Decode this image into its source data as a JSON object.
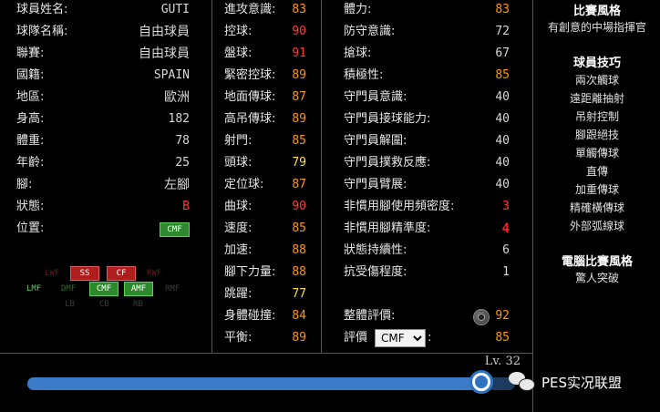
{
  "profile": {
    "rows": [
      {
        "label": "球員姓名:",
        "value": "GUTI"
      },
      {
        "label": "球隊名稱:",
        "value": "自由球員"
      },
      {
        "label": "聯賽:",
        "value": "自由球員"
      },
      {
        "label": "國籍:",
        "value": "SPAIN"
      },
      {
        "label": "地區:",
        "value": "歐洲"
      },
      {
        "label": "身高:",
        "value": "182"
      },
      {
        "label": "體重:",
        "value": "78"
      },
      {
        "label": "年齡:",
        "value": "25"
      },
      {
        "label": "腳:",
        "value": "左腳"
      },
      {
        "label": "狀態:",
        "value": "B"
      }
    ],
    "position_label": "位置:",
    "position_value": "CMF",
    "position_map": {
      "row1": [
        "LWF",
        "SS",
        "CF",
        "RWF"
      ],
      "row2": [
        "LMF",
        "DMF",
        "CMF",
        "AMF",
        "RMF"
      ],
      "row3": [
        "LB",
        "CB",
        "RB"
      ]
    }
  },
  "attributes_col1": [
    {
      "label": "進攻意識:",
      "value": "83"
    },
    {
      "label": "控球:",
      "value": "90"
    },
    {
      "label": "盤球:",
      "value": "91"
    },
    {
      "label": "緊密控球:",
      "value": "89"
    },
    {
      "label": "地面傳球:",
      "value": "87"
    },
    {
      "label": "高吊傳球:",
      "value": "89"
    },
    {
      "label": "射門:",
      "value": "85"
    },
    {
      "label": "頭球:",
      "value": "79"
    },
    {
      "label": "定位球:",
      "value": "87"
    },
    {
      "label": "曲球:",
      "value": "90"
    },
    {
      "label": "速度:",
      "value": "85"
    },
    {
      "label": "加速:",
      "value": "88"
    },
    {
      "label": "腳下力量:",
      "value": "88"
    },
    {
      "label": "跳躍:",
      "value": "77"
    },
    {
      "label": "身體碰撞:",
      "value": "84"
    },
    {
      "label": "平衡:",
      "value": "89"
    }
  ],
  "attributes_col2": [
    {
      "label": "體力:",
      "value": "83"
    },
    {
      "label": "防守意識:",
      "value": "72"
    },
    {
      "label": "搶球:",
      "value": "67"
    },
    {
      "label": "積極性:",
      "value": "85"
    },
    {
      "label": "守門員意識:",
      "value": "40"
    },
    {
      "label": "守門員接球能力:",
      "value": "40"
    },
    {
      "label": "守門員解圍:",
      "value": "40"
    },
    {
      "label": "守門員撲救反應:",
      "value": "40"
    },
    {
      "label": "守門員臂展:",
      "value": "40"
    },
    {
      "label": "非慣用腳使用頻密度:",
      "value": "3"
    },
    {
      "label": "非慣用腳精準度:",
      "value": "4"
    },
    {
      "label": "狀態持續性:",
      "value": "6"
    },
    {
      "label": "抗受傷程度:",
      "value": "1"
    }
  ],
  "overall": {
    "label": "整體評價:",
    "value": "92"
  },
  "rating": {
    "label": "評價",
    "selected": "CMF",
    "colon": ":",
    "value": "85"
  },
  "sidebar": {
    "style_title": "比賽風格",
    "style_value": "有創意的中場指揮官",
    "skills_title": "球員技巧",
    "skills": [
      "兩次觸球",
      "遠距離抽射",
      "吊射控制",
      "腳跟絕技",
      "單觸傳球",
      "直傳",
      "加重傳球",
      "精確橫傳球",
      "外部弧線球"
    ],
    "ai_title": "電腦比賽風格",
    "ai_value": "驚人突破"
  },
  "level": {
    "label": "Lv. 32",
    "fill_fraction": 0.93
  },
  "watermark": "PES实况联盟",
  "colors": {
    "orange": "#ff9900",
    "yellow": "#ffe033",
    "red": "#ff3b30",
    "slider": "#3a7cc9",
    "badge_green": "#2c8a2c",
    "badge_red": "#b01d1d"
  }
}
